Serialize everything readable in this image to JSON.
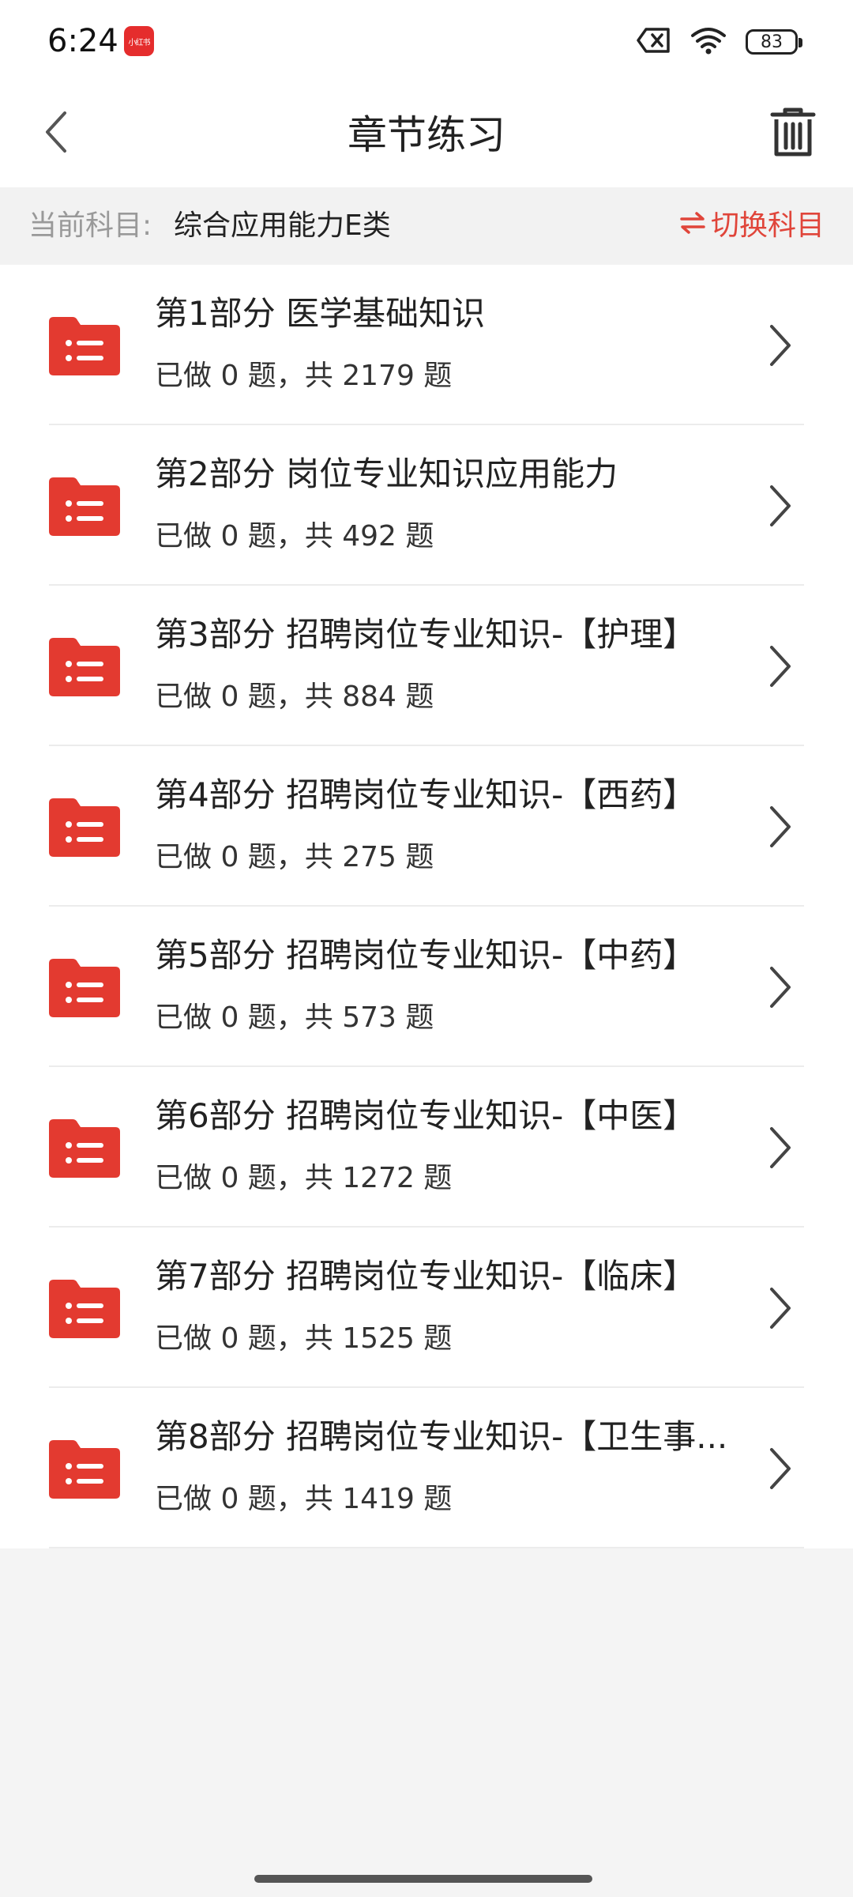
{
  "status_bar": {
    "time": "6:24",
    "app_badge_text": "小红书",
    "battery_level": "83"
  },
  "header": {
    "title": "章节练习",
    "back_icon": "chevron-left-icon",
    "delete_icon": "trash-icon"
  },
  "subject": {
    "label": "当前科目:",
    "value": "综合应用能力E类",
    "switch_label": "切换科目",
    "switch_icon": "swap-arrows-icon"
  },
  "colors": {
    "accent": "#e0453a",
    "folder": "#e33a30"
  },
  "chapters": [
    {
      "title": "第1部分 医学基础知识",
      "progress": "已做 0 题，共 2179 题"
    },
    {
      "title": "第2部分 岗位专业知识应用能力",
      "progress": "已做 0 题，共 492 题"
    },
    {
      "title": "第3部分 招聘岗位专业知识-【护理】",
      "progress": "已做 0 题，共 884 题"
    },
    {
      "title": "第4部分 招聘岗位专业知识-【西药】",
      "progress": "已做 0 题，共 275 题"
    },
    {
      "title": "第5部分 招聘岗位专业知识-【中药】",
      "progress": "已做 0 题，共 573 题"
    },
    {
      "title": "第6部分 招聘岗位专业知识-【中医】",
      "progress": "已做 0 题，共 1272 题"
    },
    {
      "title": "第7部分 招聘岗位专业知识-【临床】",
      "progress": "已做 0 题，共 1525 题"
    },
    {
      "title": "第8部分 招聘岗位专业知识-【卫生事...",
      "progress": "已做 0 题，共 1419 题"
    }
  ]
}
